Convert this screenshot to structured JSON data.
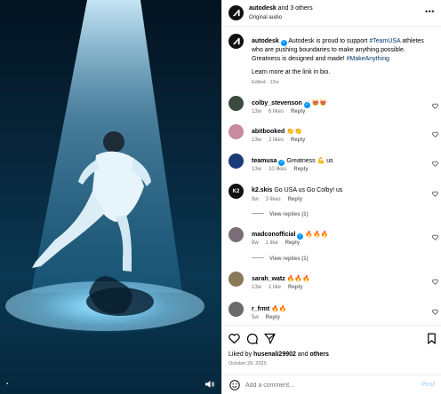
{
  "header": {
    "username": "autodesk",
    "coauthors": " and 3 others",
    "audio": "Original audio",
    "more_icon": "more-horizontal-icon"
  },
  "caption": {
    "username": "autodesk",
    "text_before": "Autodesk is proud to support ",
    "tag1": "#TeamUSA",
    "text_mid": " athletes who are pushing boundaries to make anything possible. Greatness is designed and made! ",
    "tag2": "#MakeAnything",
    "link_line": "Learn more at the link in bio.",
    "meta": "Edited · 13w"
  },
  "comments": [
    {
      "username": "colby_stevenson",
      "verified": true,
      "text": "",
      "emoji": "😻😻",
      "age": "13w",
      "likes": "6 likes",
      "reply": "Reply",
      "avatar_color": "#3a4a3c"
    },
    {
      "username": "abitbooked",
      "verified": false,
      "text": "",
      "emoji": "👏👏",
      "age": "13w",
      "likes": "2 likes",
      "reply": "Reply",
      "avatar_color": "#c98aa0"
    },
    {
      "username": "teamusa",
      "verified": true,
      "text": "Greatness 💪 us",
      "emoji": "",
      "age": "13w",
      "likes": "10 likes",
      "reply": "Reply",
      "avatar_color": "#1b3a78"
    },
    {
      "username": "k2.skis",
      "verified": false,
      "text": "Go USA us Go Colby! us",
      "emoji": "",
      "age": "9w",
      "likes": "3 likes",
      "reply": "Reply",
      "avatar_color": "#111111",
      "view_replies": "View replies (1)"
    },
    {
      "username": "madconofficial",
      "verified": true,
      "text": "",
      "emoji": "🔥🔥🔥",
      "age": "8w",
      "likes": "1 like",
      "reply": "Reply",
      "avatar_color": "#7a6f78",
      "view_replies": "View replies (1)"
    },
    {
      "username": "sarah_watz",
      "verified": false,
      "text": "",
      "emoji": "🔥🔥🔥",
      "age": "13w",
      "likes": "1 like",
      "reply": "Reply",
      "avatar_color": "#8a7a5a"
    },
    {
      "username": "r_frmt",
      "verified": false,
      "text": "",
      "emoji": "🔥🔥",
      "age": "5w",
      "likes": "",
      "reply": "Reply",
      "avatar_color": "#6b6b6b"
    }
  ],
  "actions": {
    "like_icon": "heart-icon",
    "comment_icon": "comment-icon",
    "share_icon": "share-icon",
    "save_icon": "bookmark-icon"
  },
  "likes": {
    "prefix": "Liked by ",
    "user": "husenali29902",
    "mid": " and ",
    "others": "others"
  },
  "date": "October 29, 2025",
  "composer": {
    "placeholder": "Add a comment…",
    "post_label": "Post"
  },
  "colors": {
    "verified": "#0095f6",
    "hashtag": "#00376b",
    "post_disabled": "#b3dbff"
  }
}
